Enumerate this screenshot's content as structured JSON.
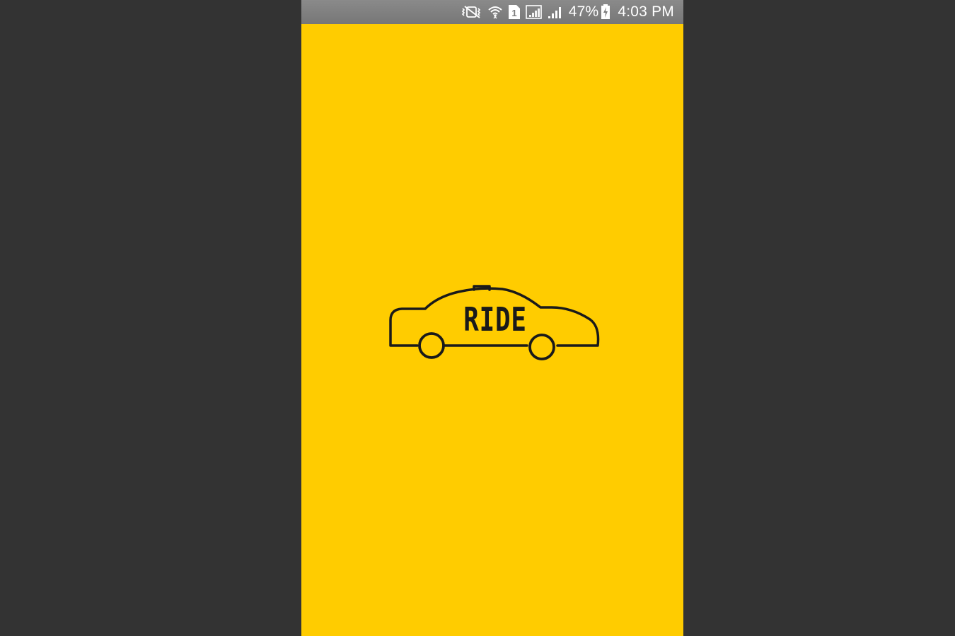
{
  "status_bar": {
    "icons": [
      "vibrate-mute-icon",
      "wifi-icon",
      "sim-1-icon",
      "signal-empty-icon",
      "signal-icon",
      "battery-charging-icon"
    ],
    "battery_text": "47%",
    "time": "4:03 PM"
  },
  "splash": {
    "background_color": "#FFCC00",
    "logo_text": "RIDE",
    "logo_icon": "taxi-car-icon"
  },
  "colors": {
    "outer_background": "#333333",
    "status_bar": "#808080",
    "logo_stroke": "#1a1a1a"
  }
}
